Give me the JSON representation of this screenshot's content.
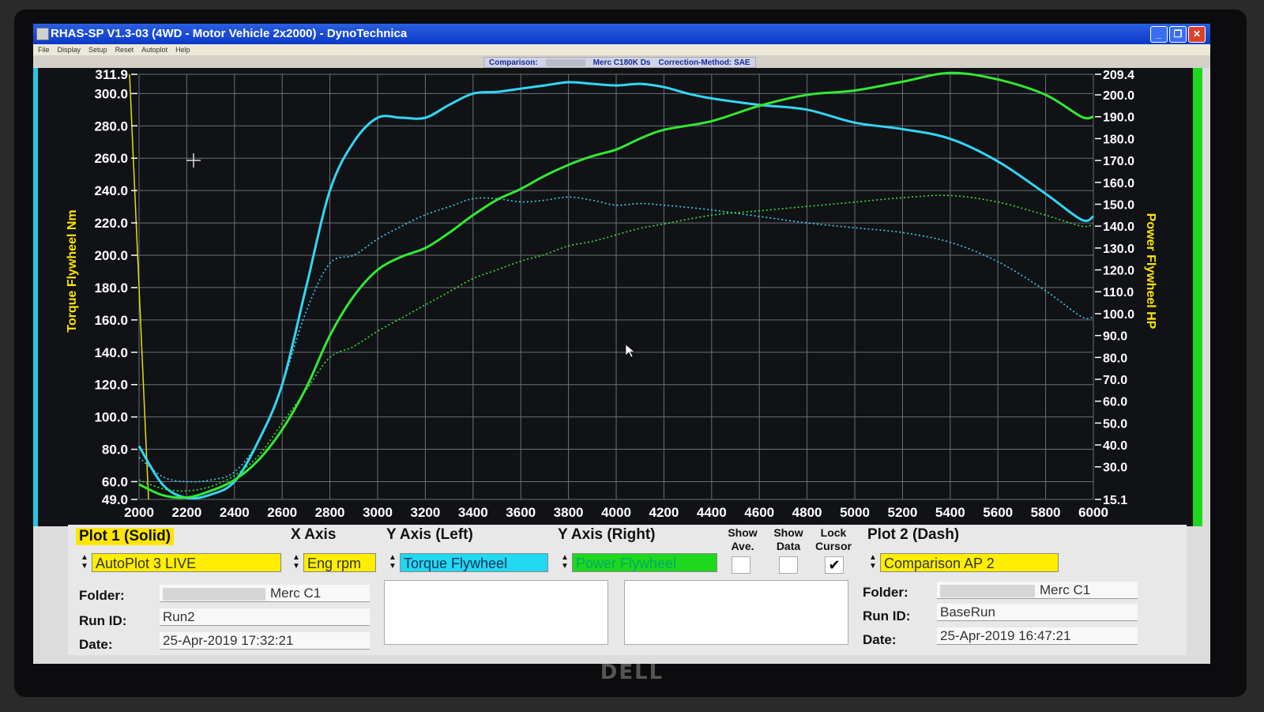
{
  "window": {
    "title": "RHAS-SP V1.3-03  (4WD - Motor Vehicle 2x2000) - DynoTechnica",
    "buttons": {
      "minimize": "_",
      "maximize": "❐",
      "close": "✕"
    }
  },
  "menu": [
    "File",
    "Display",
    "Setup",
    "Reset",
    "Autoplot",
    "Help"
  ],
  "info": {
    "comparison_label": "Comparison:",
    "vehicle": "Merc C180K Ds",
    "correction": "Correction-Method: SAE"
  },
  "colors": {
    "torque": "#33d6f2",
    "power": "#33e833",
    "grid": "#6b6f78",
    "plot_bg": "#101216",
    "axis_text": "#ffffff",
    "axis_title": "#ffe500"
  },
  "chart_data": {
    "type": "line",
    "xlabel": "",
    "ylabel_left": "Torque Flywheel Nm",
    "ylabel_right": "Power Flywheel HP",
    "xlim": [
      2000,
      6000
    ],
    "ylim_left": [
      49.0,
      311.9
    ],
    "ylim_right": [
      15.1,
      209.4
    ],
    "x_ticks": [
      "2000",
      "2200",
      "2400",
      "2600",
      "2800",
      "3000",
      "3200",
      "3400",
      "3600",
      "3800",
      "4000",
      "4200",
      "4400",
      "4600",
      "4800",
      "5000",
      "5200",
      "5400",
      "5600",
      "5800",
      "6000"
    ],
    "y_left_ticks": [
      "311.9",
      "300.0",
      "280.0",
      "260.0",
      "240.0",
      "220.0",
      "200.0",
      "180.0",
      "160.0",
      "140.0",
      "120.0",
      "100.0",
      "80.0",
      "60.0",
      "49.0"
    ],
    "y_right_ticks": [
      "209.4",
      "200.0",
      "190.0",
      "180.0",
      "170.0",
      "160.0",
      "150.0",
      "140.0",
      "130.0",
      "120.0",
      "110.0",
      "100.0",
      "90.0",
      "80.0",
      "70.0",
      "60.0",
      "50.0",
      "40.0",
      "30.0",
      "15.1"
    ],
    "grid": true,
    "series": [
      {
        "axis": "left",
        "style": "solid",
        "color": "#33d6f2",
        "x": [
          2000,
          2100,
          2200,
          2300,
          2400,
          2500,
          2600,
          2700,
          2800,
          2900,
          3000,
          3100,
          3200,
          3300,
          3400,
          3500,
          3600,
          3700,
          3800,
          3900,
          4000,
          4100,
          4200,
          4300,
          4400,
          4600,
          4800,
          5000,
          5200,
          5400,
          5600,
          5800,
          5950,
          6000
        ],
        "y": [
          82,
          58,
          50,
          52,
          60,
          85,
          120,
          180,
          240,
          270,
          285,
          285,
          285,
          293,
          300,
          301,
          303,
          305,
          307,
          306,
          305,
          306,
          304,
          300,
          297,
          293,
          290,
          282,
          278,
          272,
          258,
          238,
          222,
          224
        ]
      },
      {
        "axis": "left",
        "style": "dash",
        "color": "#33d6f2",
        "x": [
          2000,
          2100,
          2200,
          2300,
          2400,
          2500,
          2600,
          2700,
          2800,
          2900,
          3000,
          3100,
          3200,
          3300,
          3400,
          3500,
          3600,
          3700,
          3800,
          3900,
          4000,
          4100,
          4200,
          4400,
          4600,
          4800,
          5000,
          5200,
          5400,
          5600,
          5800,
          5950,
          6000
        ],
        "y": [
          75,
          63,
          60,
          61,
          66,
          85,
          120,
          165,
          195,
          200,
          210,
          218,
          225,
          230,
          235,
          235,
          233,
          234,
          236,
          234,
          231,
          232,
          231,
          228,
          224,
          220,
          217,
          214,
          208,
          196,
          178,
          162,
          162
        ]
      },
      {
        "axis": "right",
        "style": "solid",
        "color": "#33e833",
        "x": [
          2000,
          2100,
          2200,
          2300,
          2400,
          2500,
          2600,
          2700,
          2800,
          2900,
          3000,
          3100,
          3200,
          3300,
          3400,
          3500,
          3600,
          3700,
          3800,
          3900,
          4000,
          4100,
          4200,
          4400,
          4600,
          4800,
          5000,
          5200,
          5400,
          5600,
          5800,
          5950,
          6000
        ],
        "y": [
          22,
          17,
          16,
          19,
          24,
          33,
          47,
          66,
          90,
          108,
          120,
          126,
          130,
          137,
          145,
          152,
          157,
          163,
          168,
          172,
          175,
          180,
          184,
          188,
          195,
          200,
          202,
          206,
          210,
          207,
          200,
          190,
          190
        ]
      },
      {
        "axis": "right",
        "style": "dash",
        "color": "#33e833",
        "x": [
          2000,
          2100,
          2200,
          2300,
          2400,
          2500,
          2600,
          2700,
          2800,
          2900,
          3000,
          3100,
          3200,
          3300,
          3400,
          3500,
          3600,
          3700,
          3800,
          3900,
          4000,
          4100,
          4200,
          4400,
          4600,
          4800,
          5000,
          5200,
          5400,
          5600,
          5800,
          5950,
          6000
        ],
        "y": [
          24,
          20,
          19,
          21,
          26,
          35,
          50,
          65,
          80,
          85,
          92,
          98,
          104,
          110,
          116,
          120,
          124,
          127,
          131,
          133,
          136,
          139,
          141,
          145,
          147,
          149,
          151,
          153,
          154,
          151,
          145,
          140,
          141
        ]
      }
    ]
  },
  "panel": {
    "plot1_header": "Plot 1 (Solid)",
    "xaxis_header": "X Axis",
    "yleft_header": "Y Axis (Left)",
    "yright_header": "Y Axis (Right)",
    "show_ave": "Show Ave.",
    "show_data": "Show Data",
    "lock_cursor": "Lock Cursor",
    "plot2_header": "Plot 2 (Dash)",
    "plot1_select": "AutoPlot 3 LIVE",
    "xaxis_select": "Eng rpm",
    "yleft_select": "Torque Flywheel",
    "yright_select": "Power Flywheel",
    "plot2_select": "Comparison AP 2",
    "lock_cursor_check": "✔",
    "folder_label": "Folder:",
    "runid_label": "Run ID:",
    "date_label": "Date:",
    "plot1_folder": "Merc C1",
    "plot1_runid": "Run2",
    "plot1_date": "25-Apr-2019  17:32:21",
    "plot2_folder": "Merc C1",
    "plot2_runid": "BaseRun",
    "plot2_date": "25-Apr-2019  16:47:21"
  },
  "monitor_brand": "DELL"
}
